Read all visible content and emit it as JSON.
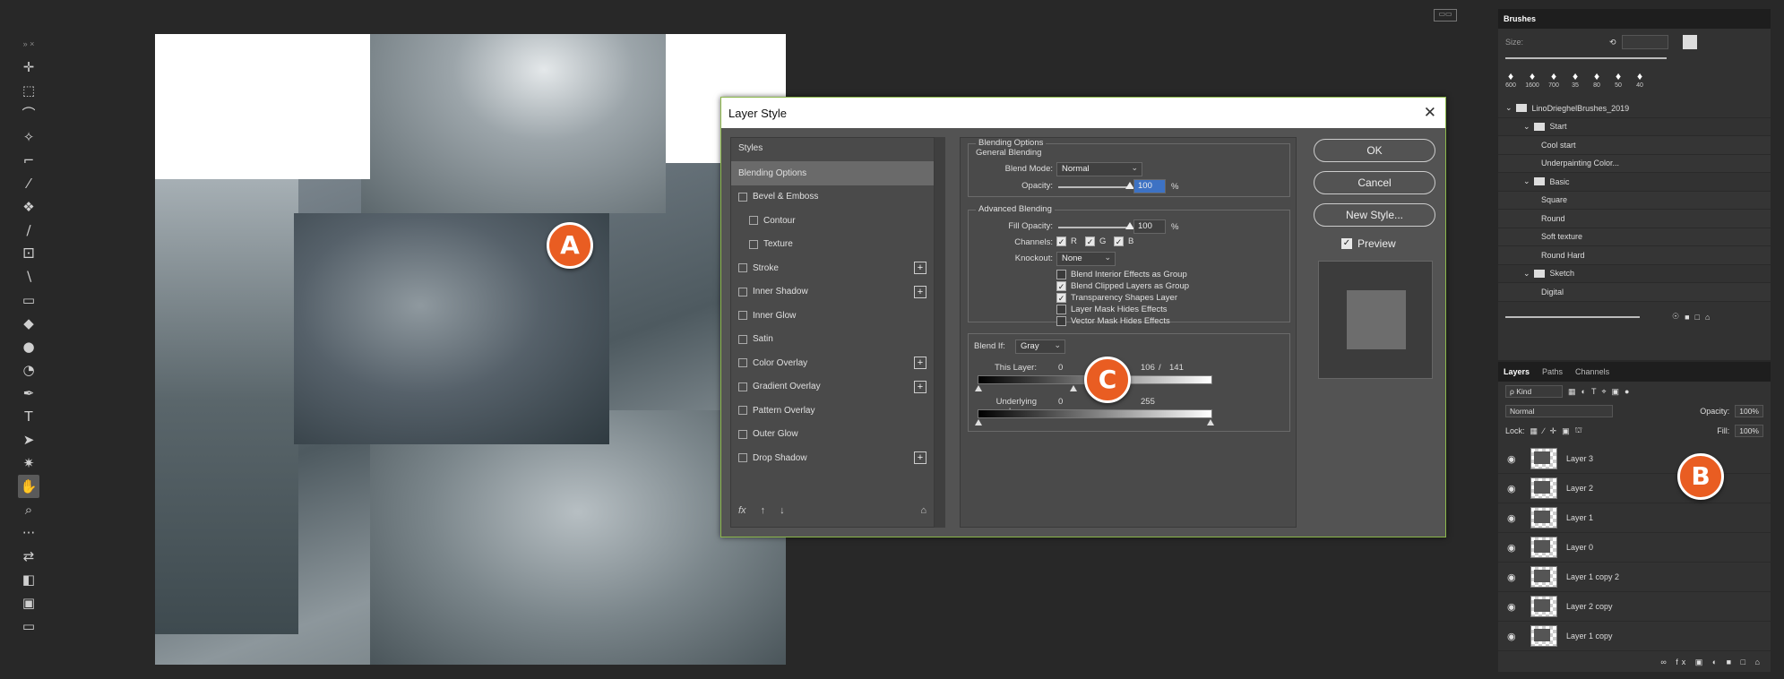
{
  "toolbar": {
    "grip": "» ×",
    "tools": [
      {
        "name": "move-icon",
        "glyph": "✛"
      },
      {
        "name": "marquee-icon",
        "glyph": "⬚"
      },
      {
        "name": "lasso-icon",
        "glyph": "⌒"
      },
      {
        "name": "magic-wand-icon",
        "glyph": "✧"
      },
      {
        "name": "crop-icon",
        "glyph": "⌐"
      },
      {
        "name": "eyedropper-icon",
        "glyph": "⁄"
      },
      {
        "name": "healing-brush-icon",
        "glyph": "❖"
      },
      {
        "name": "brush-icon",
        "glyph": "∕"
      },
      {
        "name": "clone-stamp-icon",
        "glyph": "⚀"
      },
      {
        "name": "history-brush-icon",
        "glyph": "∖"
      },
      {
        "name": "eraser-icon",
        "glyph": "▭"
      },
      {
        "name": "paint-bucket-icon",
        "glyph": "◆"
      },
      {
        "name": "blur-icon",
        "glyph": "●"
      },
      {
        "name": "dodge-icon",
        "glyph": "◔"
      },
      {
        "name": "pen-icon",
        "glyph": "✒"
      },
      {
        "name": "type-icon",
        "glyph": "T"
      },
      {
        "name": "path-selection-icon",
        "glyph": "➤"
      },
      {
        "name": "custom-shape-icon",
        "glyph": "✷"
      },
      {
        "name": "hand-icon",
        "glyph": "✋"
      },
      {
        "name": "zoom-icon",
        "glyph": "⌕"
      },
      {
        "name": "more-tools-icon",
        "glyph": "···"
      },
      {
        "name": "swap-colors-icon",
        "glyph": "⇄"
      },
      {
        "name": "color-swatches-icon",
        "glyph": "◧"
      },
      {
        "name": "quick-mask-icon",
        "glyph": "▣"
      },
      {
        "name": "screen-mode-icon",
        "glyph": "▭"
      }
    ]
  },
  "badges": {
    "a": "A",
    "b": "B",
    "c": "C"
  },
  "colors": {
    "badge": "#e95d22",
    "dialog_border": "#8cb84b"
  },
  "dialog": {
    "title": "Layer Style",
    "close": "✕",
    "styles_header": "Styles",
    "styles": [
      {
        "label": "Blending Options",
        "checkbox": false,
        "selected": true,
        "indent": false,
        "plus": false
      },
      {
        "label": "Bevel & Emboss",
        "checkbox": true,
        "selected": false,
        "indent": false,
        "plus": false
      },
      {
        "label": "Contour",
        "checkbox": true,
        "selected": false,
        "indent": true,
        "plus": false
      },
      {
        "label": "Texture",
        "checkbox": true,
        "selected": false,
        "indent": true,
        "plus": false
      },
      {
        "label": "Stroke",
        "checkbox": true,
        "selected": false,
        "indent": false,
        "plus": true
      },
      {
        "label": "Inner Shadow",
        "checkbox": true,
        "selected": false,
        "indent": false,
        "plus": true
      },
      {
        "label": "Inner Glow",
        "checkbox": true,
        "selected": false,
        "indent": false,
        "plus": false
      },
      {
        "label": "Satin",
        "checkbox": true,
        "selected": false,
        "indent": false,
        "plus": false
      },
      {
        "label": "Color Overlay",
        "checkbox": true,
        "selected": false,
        "indent": false,
        "plus": true
      },
      {
        "label": "Gradient Overlay",
        "checkbox": true,
        "selected": false,
        "indent": false,
        "plus": true
      },
      {
        "label": "Pattern Overlay",
        "checkbox": true,
        "selected": false,
        "indent": false,
        "plus": false
      },
      {
        "label": "Outer Glow",
        "checkbox": true,
        "selected": false,
        "indent": false,
        "plus": false
      },
      {
        "label": "Drop Shadow",
        "checkbox": true,
        "selected": false,
        "indent": false,
        "plus": true
      }
    ],
    "footer": {
      "fx": "fx",
      "up": "↑",
      "down": "↓",
      "trash": "⌂"
    },
    "blending": {
      "section": "Blending Options",
      "general": "General Blending",
      "blend_mode_label": "Blend Mode:",
      "blend_mode_value": "Normal",
      "opacity_label": "Opacity:",
      "opacity_value": "100",
      "opacity_level": 1.0,
      "percent": "%",
      "advanced": "Advanced Blending",
      "fill_label": "Fill Opacity:",
      "fill_value": "100",
      "fill_level": 1.0,
      "channels_label": "Channels:",
      "channels": [
        "R",
        "G",
        "B"
      ],
      "knockout_label": "Knockout:",
      "knockout_value": "None",
      "options": [
        {
          "label": "Blend Interior Effects as Group",
          "checked": false
        },
        {
          "label": "Blend Clipped Layers as Group",
          "checked": true
        },
        {
          "label": "Transparency Shapes Layer",
          "checked": true
        },
        {
          "label": "Layer Mask Hides Effects",
          "checked": false
        },
        {
          "label": "Vector Mask Hides Effects",
          "checked": false
        }
      ],
      "blend_if_label": "Blend If:",
      "blend_if_value": "Gray",
      "this_layer_label": "This Layer:",
      "this_layer_low": "0",
      "this_layer_high": "106",
      "this_layer_sep": "/",
      "this_layer_high2": "141",
      "underlying_label": "Underlying Layers:",
      "underlying_low": "0",
      "underlying_high": "255"
    },
    "buttons": {
      "ok": "OK",
      "cancel": "Cancel",
      "new_style": "New Style...",
      "preview": "Preview"
    }
  },
  "restore": "▭▭",
  "brushes": {
    "tab": "Brushes",
    "size_label": "Size:",
    "sizes": [
      "600",
      "1600",
      "700",
      "35",
      "80",
      "50",
      "40"
    ],
    "tree": [
      {
        "label": "LinoDrieghelBrushes_2019",
        "level": 0,
        "folder": true
      },
      {
        "label": "Start",
        "level": 1,
        "folder": true
      },
      {
        "label": "Cool start",
        "level": 2,
        "folder": false
      },
      {
        "label": "Underpainting Color...",
        "level": 2,
        "folder": false
      },
      {
        "label": "Basic",
        "level": 1,
        "folder": true
      },
      {
        "label": "Square",
        "level": 2,
        "folder": false
      },
      {
        "label": "Round",
        "level": 2,
        "folder": false
      },
      {
        "label": "Soft texture",
        "level": 2,
        "folder": false
      },
      {
        "label": "Round Hard",
        "level": 2,
        "folder": false
      },
      {
        "label": "Sketch",
        "level": 1,
        "folder": true
      },
      {
        "label": "Digital",
        "level": 2,
        "folder": false
      }
    ]
  },
  "layers": {
    "tabs": [
      "Layers",
      "Paths",
      "Channels"
    ],
    "kind": "ρ Kind",
    "mode": "Normal",
    "opacity_label": "Opacity:",
    "opacity_value": "100%",
    "lock_label": "Lock:",
    "fill_label": "Fill:",
    "fill_value": "100%",
    "items": [
      "Layer 3",
      "Layer 2",
      "Layer 1",
      "Layer 0",
      "Layer 1 copy 2",
      "Layer 2 copy",
      "Layer 1 copy"
    ],
    "footer": "∞ fx ▣ ◐ ■ □ ⌂"
  }
}
